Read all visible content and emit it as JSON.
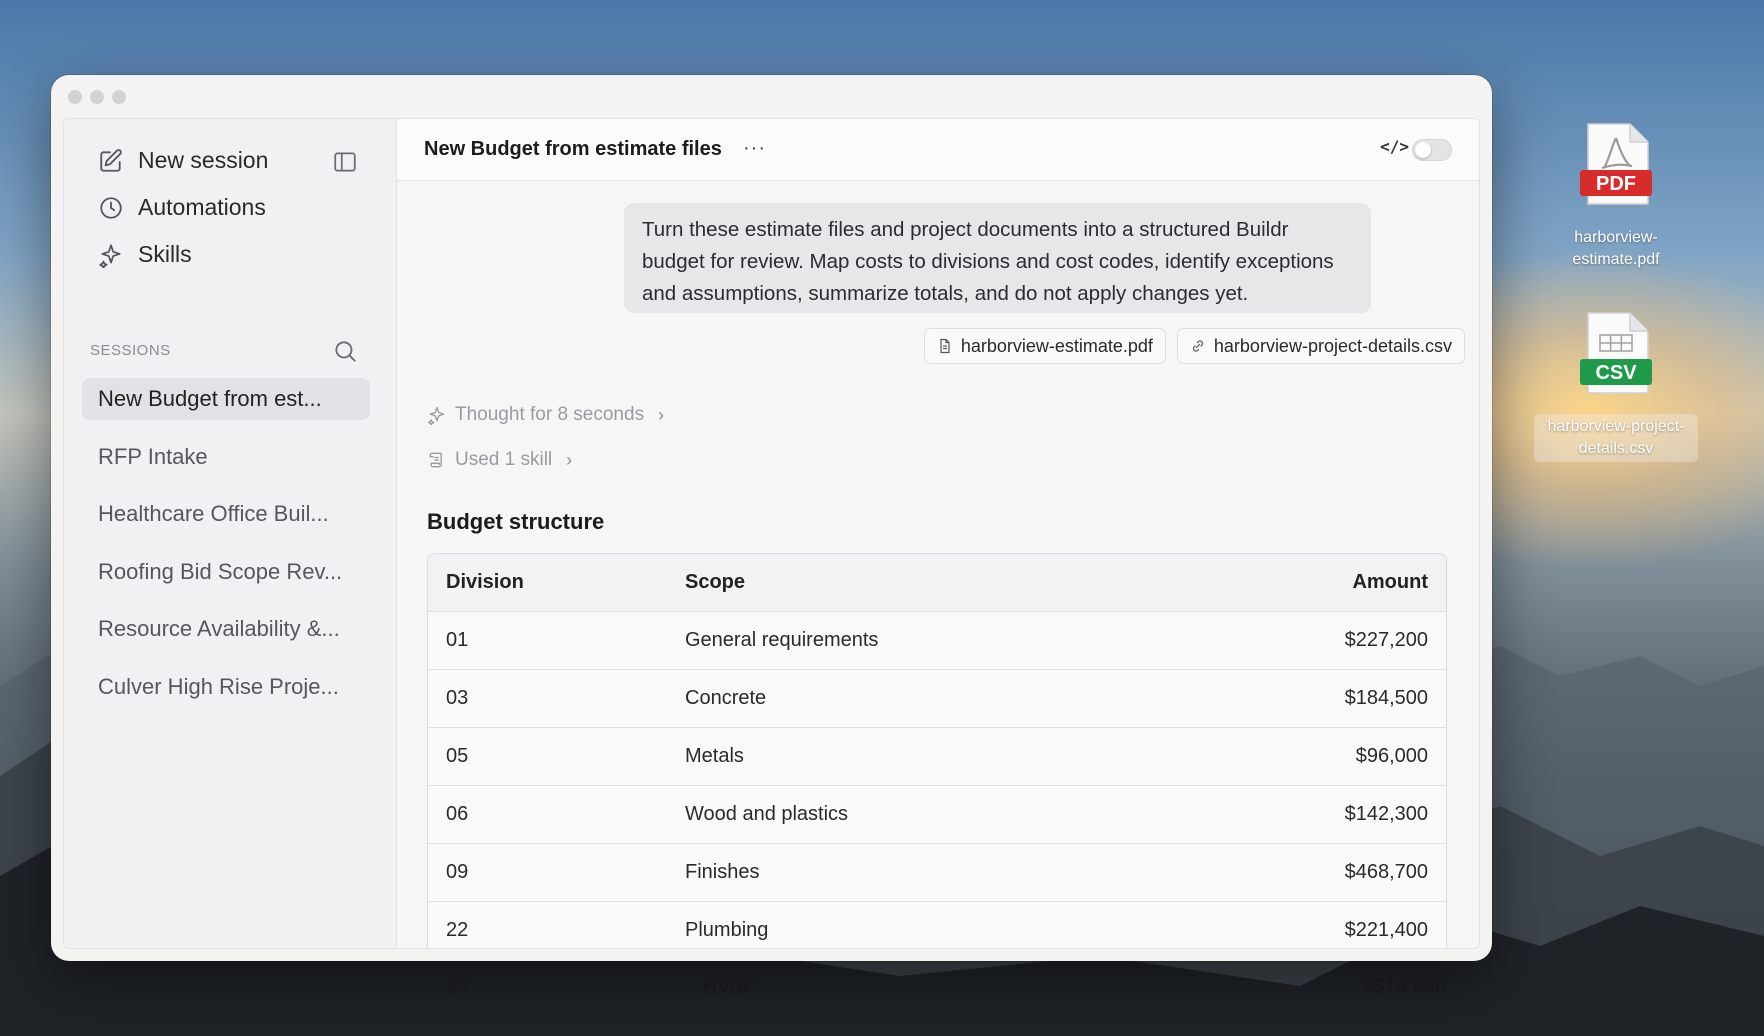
{
  "sidebar": {
    "new_session": "New session",
    "automations": "Automations",
    "skills": "Skills",
    "sessions_label": "SESSIONS",
    "sessions": [
      {
        "label": "New Budget from est..."
      },
      {
        "label": "RFP Intake"
      },
      {
        "label": "Healthcare Office Buil..."
      },
      {
        "label": "Roofing Bid Scope Rev..."
      },
      {
        "label": "Resource Availability &..."
      },
      {
        "label": "Culver High Rise Proje..."
      }
    ]
  },
  "header": {
    "title": "New Budget from estimate files",
    "more": "···",
    "code_toggle": "</>"
  },
  "prompt": {
    "text": "Turn these estimate files and project documents into a structured Buildr budget for review. Map costs to divisions and cost codes, identify exceptions and assumptions, summarize totals, and do not apply changes yet."
  },
  "attachments": [
    {
      "name": "harborview-estimate.pdf",
      "icon": "file-icon"
    },
    {
      "name": "harborview-project-details.csv",
      "icon": "link-icon"
    }
  ],
  "steps": {
    "thought": "Thought for 8 seconds",
    "skill": "Used 1 skill"
  },
  "budget": {
    "heading": "Budget structure",
    "columns": {
      "division": "Division",
      "scope": "Scope",
      "amount": "Amount"
    },
    "rows": [
      {
        "division": "01",
        "scope": "General requirements",
        "amount": "$227,200"
      },
      {
        "division": "03",
        "scope": "Concrete",
        "amount": "$184,500"
      },
      {
        "division": "05",
        "scope": "Metals",
        "amount": "$96,000"
      },
      {
        "division": "06",
        "scope": "Wood and plastics",
        "amount": "$142,300"
      },
      {
        "division": "09",
        "scope": "Finishes",
        "amount": "$468,700"
      },
      {
        "division": "22",
        "scope": "Plumbing",
        "amount": "$221,400"
      }
    ],
    "overflow_row": {
      "division": "23",
      "scope": "HVAC",
      "amount": "$514,800"
    }
  },
  "desktop": {
    "pdf": {
      "badge": "PDF",
      "label_line1": "harborview-",
      "label_line2": "estimate.pdf",
      "badge_color": "#d82b2b"
    },
    "csv": {
      "badge": "CSV",
      "label_line1": "harborview-project-",
      "label_line2": "details.csv",
      "badge_color": "#1f9a4a"
    }
  }
}
